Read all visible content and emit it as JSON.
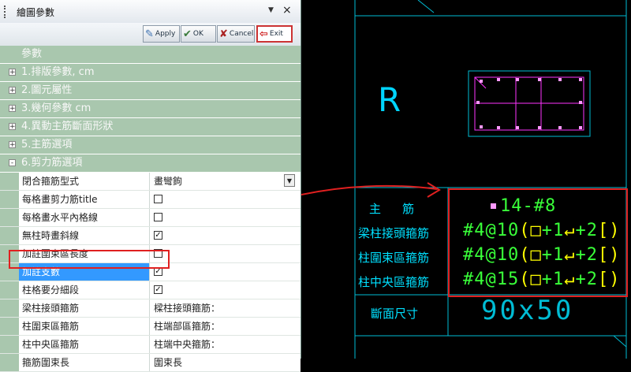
{
  "panel": {
    "title": "繪圖參數",
    "toolbar": {
      "apply": "Apply",
      "ok": "OK",
      "cancel": "Cancel",
      "exit": "Exit"
    },
    "header": "參數",
    "groups": [
      {
        "label": "1.排版參數, cm",
        "expander": "+"
      },
      {
        "label": "2.圖元屬性",
        "expander": "+"
      },
      {
        "label": "3.幾何參數 cm",
        "expander": "+"
      },
      {
        "label": "4.異動主筋斷面形狀",
        "expander": "+"
      },
      {
        "label": "5.主筋選項",
        "expander": "+"
      },
      {
        "label": "6.剪力筋選項",
        "expander": "-"
      }
    ],
    "properties": [
      {
        "name": "閉合箍筋型式",
        "value": "畫彎鉤",
        "type": "dropdown"
      },
      {
        "name": "每格畫剪力筋title",
        "value": "",
        "checked": false,
        "type": "check"
      },
      {
        "name": "每格畫水平內格線",
        "value": "",
        "checked": false,
        "type": "check"
      },
      {
        "name": "無柱時畫斜線",
        "value": "",
        "checked": true,
        "type": "check"
      },
      {
        "name": "加註圍束區長度",
        "value": "",
        "checked": false,
        "type": "check"
      },
      {
        "name": "加註支數",
        "value": "",
        "checked": true,
        "type": "check",
        "selected": true
      },
      {
        "name": "柱格要分細段",
        "value": "",
        "checked": true,
        "type": "check"
      },
      {
        "name": "梁柱接頭箍筋",
        "value": "樑柱接頭箍筋：",
        "type": "text"
      },
      {
        "name": "柱圍束區箍筋",
        "value": "柱端部區箍筋：",
        "type": "text"
      },
      {
        "name": "柱中央區箍筋",
        "value": "柱端中央箍筋：",
        "type": "text"
      },
      {
        "name": "箍筋圍束長",
        "value": "圍束長",
        "type": "text"
      }
    ]
  },
  "cad": {
    "section_letter": "R",
    "main_label": "主　筋",
    "main_value": "14-#8",
    "rows": [
      {
        "label": "梁柱接頭箍筋",
        "value": "#4@10",
        "suffix": "+1",
        "tail": "+2"
      },
      {
        "label": "柱圍束區箍筋",
        "value": "#4@10",
        "suffix": "+1",
        "tail": "+2"
      },
      {
        "label": "柱中央區箍筋",
        "value": "#4@15",
        "suffix": "+1",
        "tail": "+2"
      }
    ],
    "size_label": "斷面尺寸",
    "size_value": "90x50"
  }
}
